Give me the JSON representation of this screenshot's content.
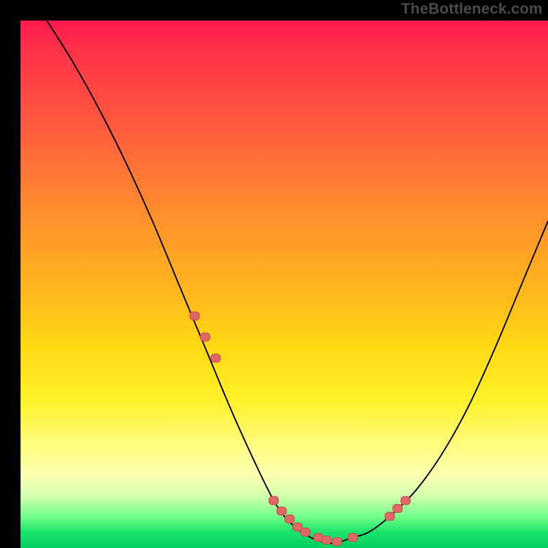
{
  "watermark": "TheBottleneck.com",
  "colors": {
    "curve": "#000000",
    "marker_fill": "#e06765",
    "marker_stroke": "#c14f4d",
    "frame_bg": "#000000",
    "gradient_top": "#ff1a4d",
    "gradient_bottom": "#00d060"
  },
  "chart_data": {
    "type": "line",
    "title": "",
    "xlabel": "",
    "ylabel": "",
    "xlim": [
      0,
      100
    ],
    "ylim": [
      0,
      100
    ],
    "grid": false,
    "legend_visible": false,
    "series": [
      {
        "name": "bottleneck-curve",
        "x": [
          5,
          10,
          15,
          20,
          25,
          30,
          35,
          40,
          45,
          48,
          50,
          52,
          55,
          58,
          60,
          63,
          66,
          70,
          75,
          80,
          85,
          90,
          95,
          100
        ],
        "y": [
          100,
          92,
          83,
          73,
          62,
          50,
          38,
          26,
          15,
          9,
          6,
          4,
          2,
          1,
          1,
          2,
          3,
          6,
          11,
          18,
          27,
          38,
          50,
          62
        ]
      }
    ],
    "markers": {
      "name": "highlighted-points",
      "shape": "rounded-rect",
      "x": [
        33,
        35,
        37,
        48,
        49.5,
        51,
        52.5,
        54,
        56.5,
        58,
        60,
        63,
        70,
        71.5,
        73
      ],
      "y": [
        44,
        40,
        36,
        9,
        7,
        5.5,
        4,
        3,
        2,
        1.5,
        1.2,
        2,
        6,
        7.5,
        9
      ]
    },
    "annotations": []
  }
}
